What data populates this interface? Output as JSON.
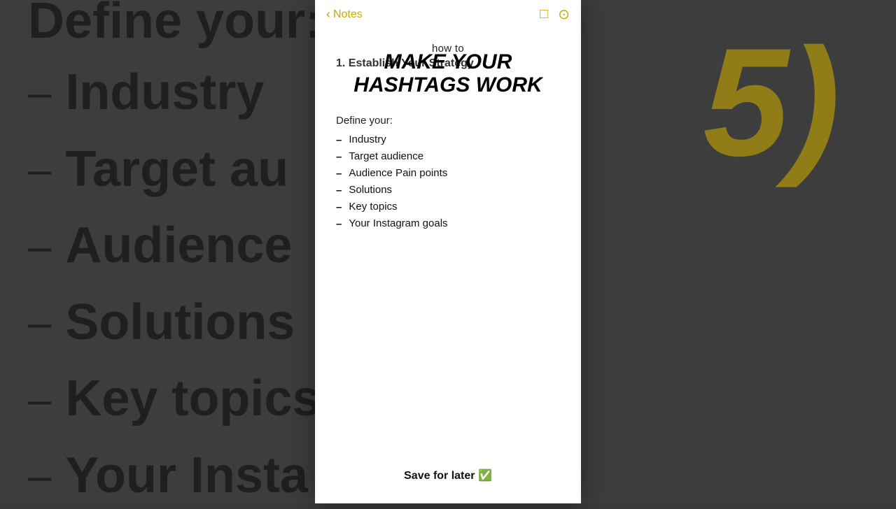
{
  "background": {
    "left_lines": [
      "Define your:",
      "Industry",
      "Target au...",
      "Audience...",
      "Solutions",
      "Key topics",
      "Your Insta..."
    ],
    "number": "5)"
  },
  "topbar": {
    "back_label": "Notes",
    "icon1": "□",
    "icon2": "⊙"
  },
  "content": {
    "subtitle": "how to",
    "main_title_line1": "MAKE YOUR",
    "main_title_line2": "HASHTAGS WORK",
    "step": "1. Establish Your Strategy",
    "define_label": "Define your:",
    "list_items": [
      "Industry",
      "Target audience",
      "Audience Pain points",
      "Solutions",
      "Key topics",
      "Your Instagram goals"
    ],
    "save_later": "Save for later ✅"
  }
}
